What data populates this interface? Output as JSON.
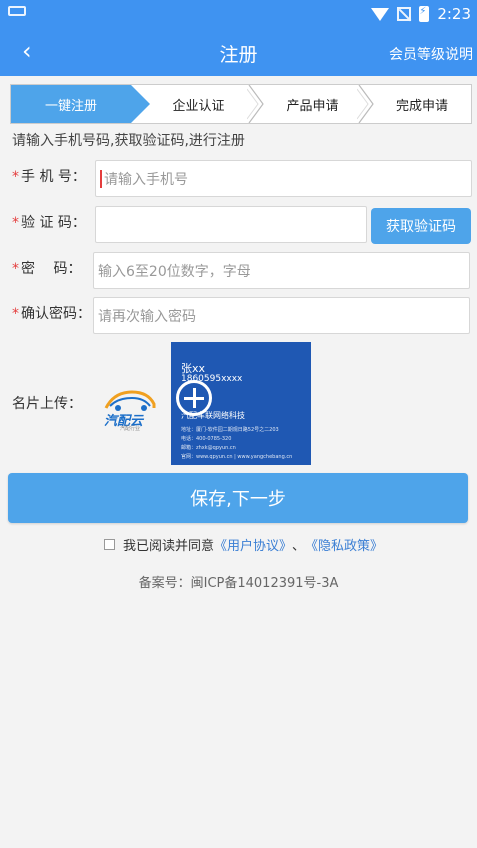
{
  "status_bar": {
    "time": "2:23"
  },
  "header": {
    "back_icon": "‹",
    "title": "注册",
    "right_action": "会员等级说明"
  },
  "steps": [
    {
      "label": "一键注册",
      "active": true
    },
    {
      "label": "企业认证",
      "active": false
    },
    {
      "label": "产品申请",
      "active": false
    },
    {
      "label": "完成申请",
      "active": false
    }
  ],
  "hint": "请输入手机号码,获取验证码,进行注册",
  "form": {
    "required_mark": "*",
    "phone": {
      "label": "手 机 号：",
      "placeholder": "请输入手机号"
    },
    "code": {
      "label": "验 证 码：",
      "placeholder": "",
      "button": "获取验证码"
    },
    "password": {
      "label": "密　 码：",
      "placeholder": "输入6至20位数字，字母"
    },
    "confirm": {
      "label": "确认密码：",
      "placeholder": "请再次输入密码"
    }
  },
  "upload": {
    "label": "名片上传：",
    "logo_text": "汽配云",
    "logo_sub": "汽配行业",
    "card": {
      "name": "张xx",
      "phone": "1860595xxxx",
      "company": "汽配车联网络科技",
      "lines": [
        "地址：厦门-软件园二期观日路52号之二203",
        "电话：400-0785-320",
        "邮箱：zhxk@qpyun.cn",
        "官网：www.qpyun.cn | www.yangchebang.cn"
      ]
    }
  },
  "save_button": "保存,下一步",
  "agreement": {
    "prefix": "我已阅读并同意",
    "user_link": "《用户协议》",
    "separator": "、",
    "privacy_link": "《隐私政策》"
  },
  "record": "备案号：闽ICP备14012391号-3A"
}
